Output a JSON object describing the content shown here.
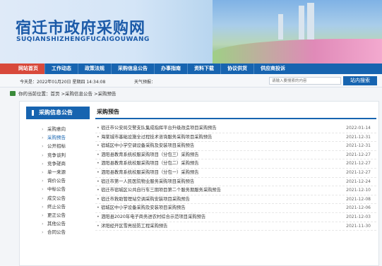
{
  "header": {
    "title": "宿迁市政府采购网",
    "pinyin": "SUQIANSHIZHENGFUCAIGOUWANG"
  },
  "nav": [
    {
      "label": "网站首页",
      "active": true
    },
    {
      "label": "工作动态"
    },
    {
      "label": "政策法规"
    },
    {
      "label": "采购信息公告"
    },
    {
      "label": "办事指南"
    },
    {
      "label": "资料下载"
    },
    {
      "label": "协议供货"
    },
    {
      "label": "供应商投诉"
    }
  ],
  "infobar": {
    "date": "今天是：2022年01月20日  星期四  14:34:08",
    "weather": "天气预报："
  },
  "search": {
    "placeholder": "请输入要搜索的内容",
    "button": "站内搜索"
  },
  "breadcrumb": "你的当前位置：首页 >采购信息公告 >采购预告",
  "sidebar": {
    "title": "采购信息公告",
    "items": [
      "采购意向",
      "采购预告",
      "公开招标",
      "竞争谈判",
      "竞争磋商",
      "单一来源",
      "询价公告",
      "中标公告",
      "成交公告",
      "终止公告",
      "更正公告",
      "其他公告",
      "合同公告"
    ],
    "active_index": 1
  },
  "content": {
    "title": "采购预告",
    "items": [
      {
        "title": "宿迁市公安局交警支队集成指挥平台升级改造项目采购预告",
        "date": "2022-01-14"
      },
      {
        "title": "海棠城市基础设施全过程技术咨询服务采购项目采购预告",
        "date": "2021-12-31"
      },
      {
        "title": "宿城区中小学空调设备采购及安装项目采购预告",
        "date": "2021-12-31"
      },
      {
        "title": "泗阳县教育系统校服采购项目（分包三）采购预告",
        "date": "2021-12-27"
      },
      {
        "title": "泗阳县教育系统校服采购项目（分包二）采购预告",
        "date": "2021-12-27"
      },
      {
        "title": "泗阳县教育系统校服采购项目（分包一）采购预告",
        "date": "2021-12-27"
      },
      {
        "title": "宿迁市第一人民医院物业服务采购项目采购预告",
        "date": "2021-12-24"
      },
      {
        "title": "宿迁市宿城区公共自行车三期项目第二个服务期服务采购预告",
        "date": "2021-12-10"
      },
      {
        "title": "宿迁市救助管理站空调采购安装项目采购预告",
        "date": "2021-12-08"
      },
      {
        "title": "宿城区中小学设备采购及安装项目采购预告",
        "date": "2021-12-06"
      },
      {
        "title": "泗阳县2020年电子商务进农村综合示范项目采购预告",
        "date": "2021-12-03"
      },
      {
        "title": "沭阳经开区雪亮技防工程采购预告",
        "date": "2021-11-30"
      }
    ]
  }
}
